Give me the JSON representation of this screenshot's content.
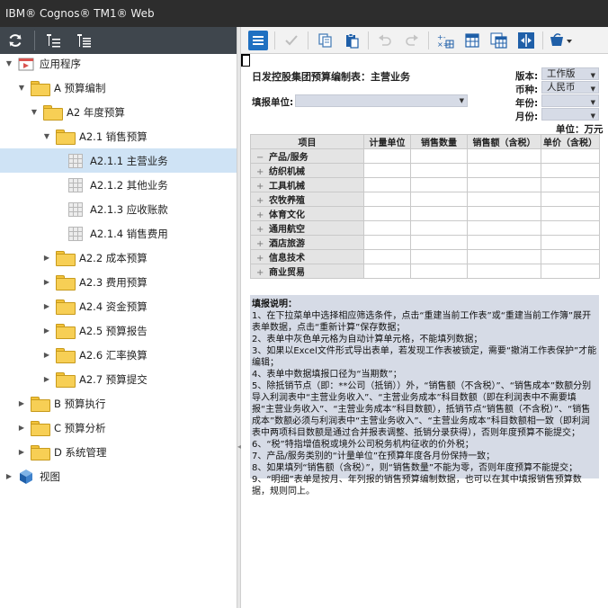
{
  "app": {
    "title": "IBM® Cognos® TM1® Web"
  },
  "tree": {
    "items": [
      {
        "label": "应用程序",
        "level": 0,
        "icon": "application-icon",
        "expanded": true
      },
      {
        "label": "A 预算编制",
        "level": 1,
        "icon": "folder-icon",
        "expanded": true
      },
      {
        "label": "A2 年度预算",
        "level": 2,
        "icon": "folder-icon",
        "expanded": true
      },
      {
        "label": "A2.1 销售预算",
        "level": 3,
        "icon": "folder-icon",
        "expanded": true
      },
      {
        "label": "A2.1.1 主营业务",
        "level": 4,
        "icon": "worksheet-icon",
        "selected": true
      },
      {
        "label": "A2.1.2 其他业务",
        "level": 4,
        "icon": "worksheet-icon"
      },
      {
        "label": "A2.1.3 应收账款",
        "level": 4,
        "icon": "worksheet-icon"
      },
      {
        "label": "A2.1.4 销售费用",
        "level": 4,
        "icon": "worksheet-icon"
      },
      {
        "label": "A2.2 成本预算",
        "level": 3,
        "icon": "folder-icon",
        "expanded": false
      },
      {
        "label": "A2.3 费用预算",
        "level": 3,
        "icon": "folder-icon",
        "expanded": false
      },
      {
        "label": "A2.4 资金预算",
        "level": 3,
        "icon": "folder-icon",
        "expanded": false
      },
      {
        "label": "A2.5 预算报告",
        "level": 3,
        "icon": "folder-icon",
        "expanded": false
      },
      {
        "label": "A2.6 汇率换算",
        "level": 3,
        "icon": "folder-icon",
        "expanded": false
      },
      {
        "label": "A2.7 预算提交",
        "level": 3,
        "icon": "folder-icon",
        "expanded": false
      },
      {
        "label": "B 预算执行",
        "level": 1,
        "icon": "folder-icon",
        "expanded": false
      },
      {
        "label": "C 预算分析",
        "level": 1,
        "icon": "folder-icon",
        "expanded": false
      },
      {
        "label": "D 系统管理",
        "level": 1,
        "icon": "folder-icon",
        "expanded": false
      },
      {
        "label": "视图",
        "level": 0,
        "icon": "views-cube-icon",
        "expanded": false
      }
    ]
  },
  "sheet": {
    "title": "日发控股集团预算编制表：主营业务",
    "unit_label": "填报单位:",
    "unit_value": "",
    "params": [
      {
        "label": "版本:",
        "value": "工作版"
      },
      {
        "label": "币种:",
        "value": "人民币"
      },
      {
        "label": "年份:",
        "value": ""
      },
      {
        "label": "月份:",
        "value": ""
      }
    ],
    "money_unit": "单位：万元",
    "columns": [
      "项目",
      "计量单位",
      "销售数量",
      "销售额（含税）",
      "单价（含税）"
    ],
    "rows": [
      {
        "label": "产品/服务",
        "sign": "−"
      },
      {
        "label": "纺织机械",
        "sign": "+"
      },
      {
        "label": "工具机械",
        "sign": "+"
      },
      {
        "label": "农牧养殖",
        "sign": "+"
      },
      {
        "label": "体育文化",
        "sign": "+"
      },
      {
        "label": "通用航空",
        "sign": "+"
      },
      {
        "label": "酒店旅游",
        "sign": "+"
      },
      {
        "label": "信息技术",
        "sign": "+"
      },
      {
        "label": "商业贸易",
        "sign": "+"
      }
    ],
    "instructions": {
      "title": "填报说明：",
      "lines": [
        "1、在下拉菜单中选择相应筛选条件，点击“重建当前工作表”或“重建当前工作簿”展开表单数据，点击“重新计算”保存数据；",
        "2、表单中灰色单元格为自动计算单元格，不能填列数据；",
        "3、如果以Excel文件形式导出表单，若发现工作表被锁定，需要“撤消工作表保护”才能编辑；",
        "4、表单中数据填报口径为“当期数”；",
        "5、除抵销节点（即：**公司（抵销））外，“销售额（不含税）”、“销售成本”数额分别导入利润表中“主营业务收入”、“主营业务成本”科目数额（即在利润表中不需要填报“主营业务收入”、“主营业务成本”科目数额），抵销节点“销售额（不含税）”、“销售成本”数额必须与利润表中“主营业务收入”、“主营业务成本”科目数额相一致（即利润表中两项科目数额是通过合并报表调整、抵销分录获得），否则年度预算不能提交；",
        "6、“税”特指增值税或境外公司税务机构征收的价外税；",
        "7、产品/服务类别的“计量单位”在预算年度各月份保持一致；",
        "8、如果填列“销售额（含税）”，则“销售数量”不能为零，否则年度预算不能提交；",
        "9、“明细”表单是按月、年列报的销售预算编制数据，也可以在其中填报销售预算数据，规则同上。"
      ]
    }
  },
  "toolbar_icons": {
    "left": [
      "refresh-icon",
      "collapse-tree-icon",
      "expand-tree-icon"
    ],
    "right": [
      "menu-icon",
      "commit-check-icon",
      "copy-icon",
      "paste-icon",
      "undo-icon",
      "redo-icon",
      "recalculate-icon",
      "rebuild-sheet-icon",
      "rebuild-book-icon",
      "fit-columns-icon",
      "sandbox-icon"
    ]
  },
  "colors": {
    "selected_row": "#cfe3f5",
    "input_cell": "#d6dbe6",
    "titlebar": "#2d2d2d",
    "left_toolbar": "#3f464d"
  }
}
